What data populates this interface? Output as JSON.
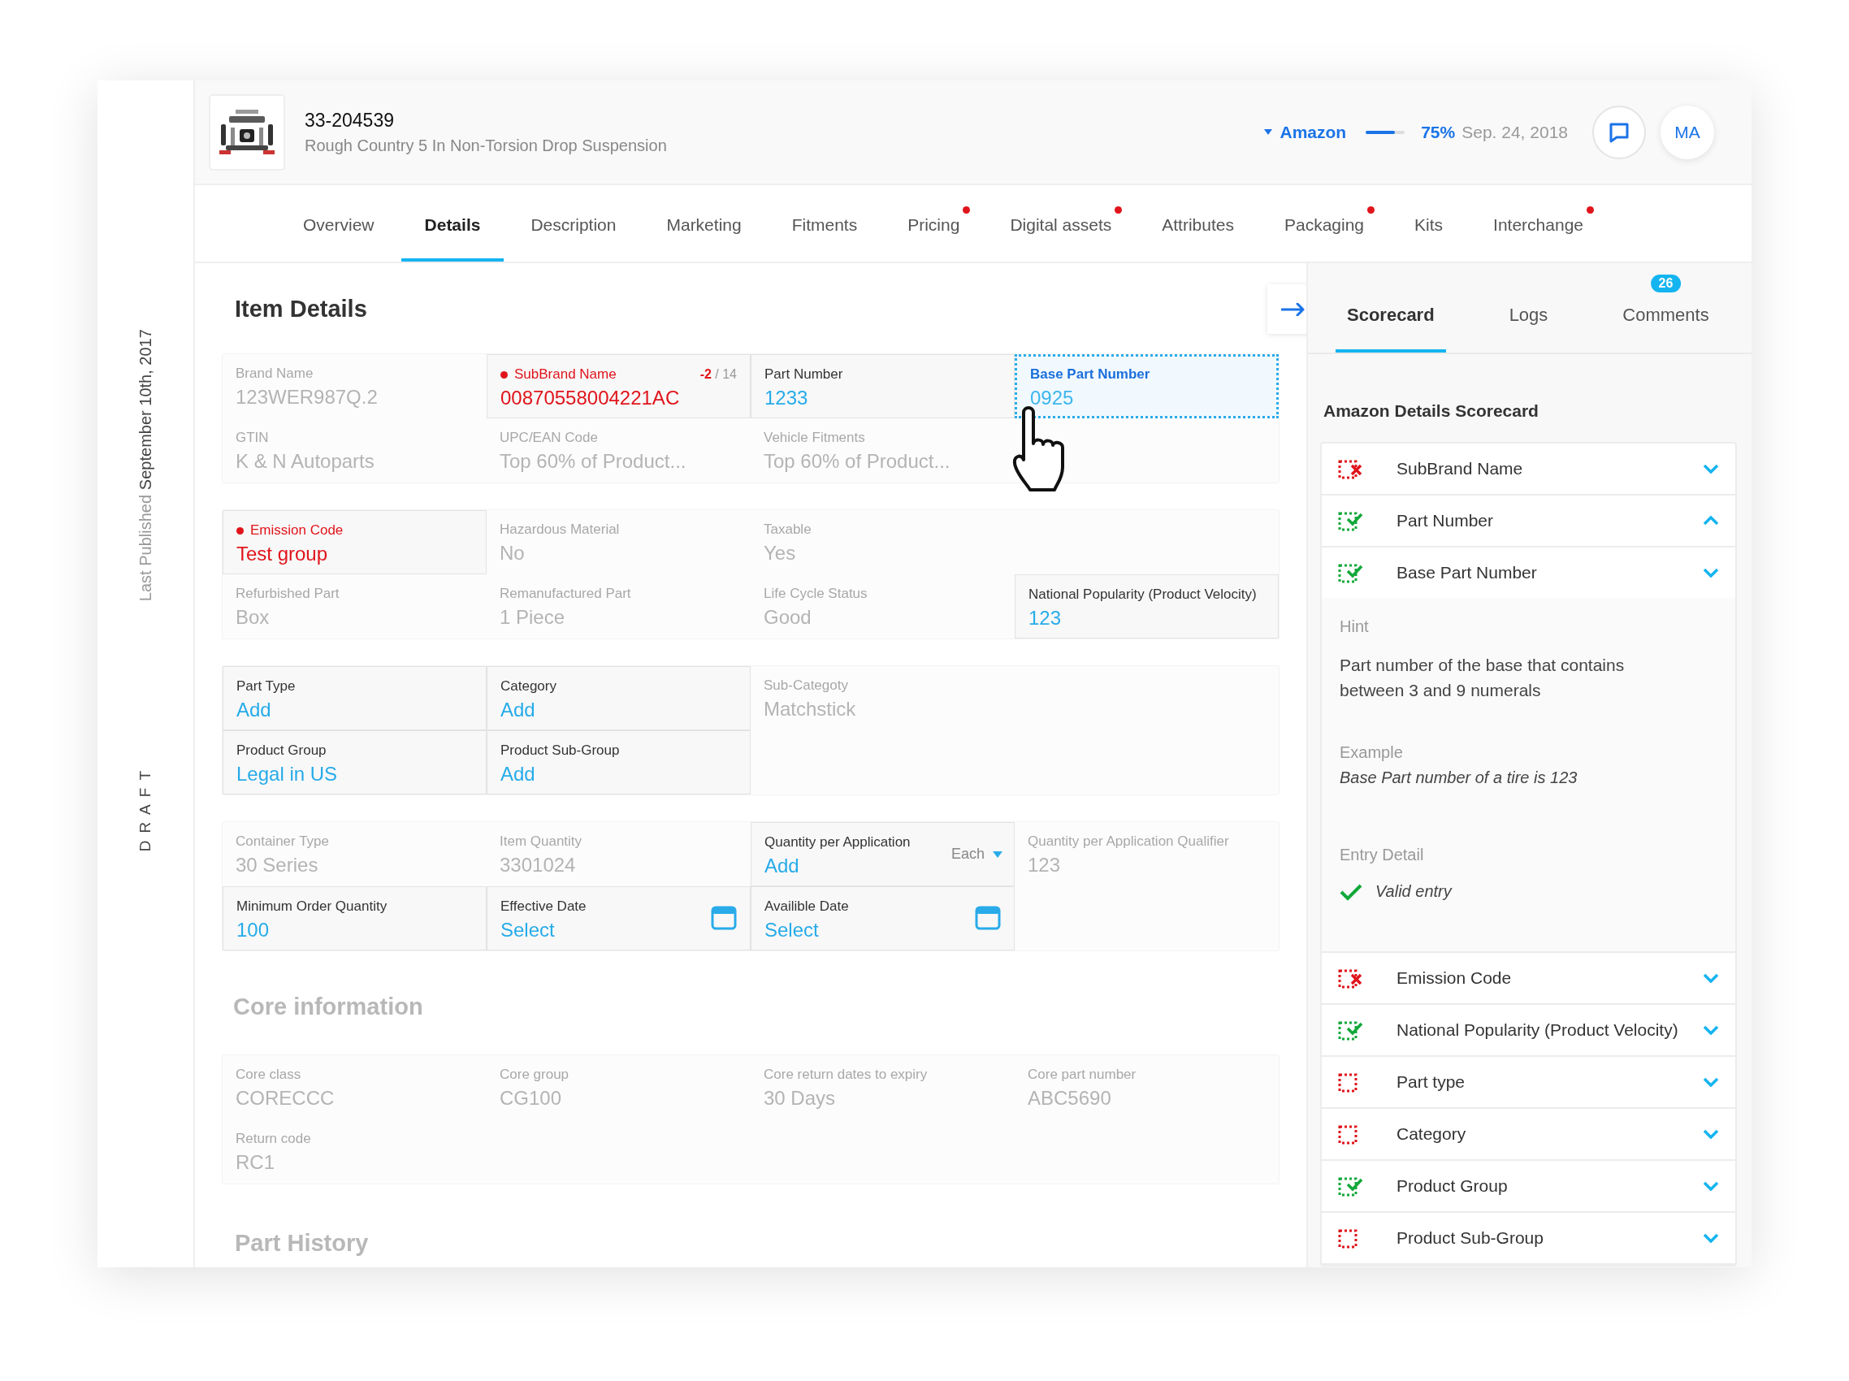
{
  "sidebar": {
    "published_label": "Last Published",
    "published_date": "September 10th, 2017",
    "status": "DRAFT"
  },
  "product": {
    "number": "33-204539",
    "name": "Rough Country 5 In Non-Torsion Drop Suspension"
  },
  "channel": {
    "name": "Amazon",
    "level": 0.75,
    "percent": "75%",
    "date": "Sep. 24, 2018"
  },
  "user": {
    "initials": "MA"
  },
  "tabs": [
    {
      "label": "Overview",
      "selected": false,
      "alert": false
    },
    {
      "label": "Details",
      "selected": true,
      "alert": false
    },
    {
      "label": "Description",
      "selected": false,
      "alert": false
    },
    {
      "label": "Marketing",
      "selected": false,
      "alert": false
    },
    {
      "label": "Fitments",
      "selected": false,
      "alert": false
    },
    {
      "label": "Pricing",
      "selected": false,
      "alert": true
    },
    {
      "label": "Digital assets",
      "selected": false,
      "alert": true
    },
    {
      "label": "Attributes",
      "selected": false,
      "alert": false
    },
    {
      "label": "Packaging",
      "selected": false,
      "alert": true
    },
    {
      "label": "Kits",
      "selected": false,
      "alert": false
    },
    {
      "label": "Interchange",
      "selected": false,
      "alert": true
    }
  ],
  "item_details": {
    "title": "Item Details",
    "sections": [
      {
        "rows": [
          [
            {
              "label": "Brand Name",
              "value": "123WER987Q.2",
              "kind": "text",
              "disabled": true,
              "invalid": false,
              "focused": false
            },
            {
              "label": "SubBrand Name",
              "value": "00870558004221AC",
              "kind": "counter",
              "disabled": false,
              "invalid": true,
              "focused": false,
              "counter": {
                "delta": "-2",
                "limit": "/ 14"
              }
            },
            {
              "label": "Part Number",
              "value": "1233",
              "kind": "text",
              "disabled": false,
              "invalid": false,
              "focused": false
            },
            {
              "label": "Base Part Number",
              "value": "0925",
              "kind": "text",
              "disabled": false,
              "invalid": false,
              "focused": true
            }
          ],
          [
            {
              "label": "GTIN",
              "value": "K & N Autoparts",
              "kind": "text",
              "disabled": true,
              "invalid": false,
              "focused": false
            },
            {
              "label": "UPC/EAN Code",
              "value": "Top 60% of Product...",
              "kind": "text",
              "disabled": true,
              "invalid": false,
              "focused": false
            },
            {
              "label": "Vehicle Fitments",
              "value": "Top 60% of Product...",
              "kind": "text",
              "disabled": true,
              "invalid": false,
              "focused": false
            }
          ]
        ]
      },
      {
        "rows": [
          [
            {
              "label": "Emission Code",
              "value": "Test group",
              "kind": "text",
              "disabled": false,
              "invalid": true,
              "focused": false
            },
            {
              "label": "Hazardous Material",
              "value": "No",
              "kind": "text",
              "disabled": true,
              "invalid": false,
              "focused": false
            },
            {
              "label": "Taxable",
              "value": "Yes",
              "kind": "text",
              "disabled": true,
              "invalid": false,
              "focused": false
            }
          ],
          [
            {
              "label": "Refurbished Part",
              "value": "Box",
              "kind": "text",
              "disabled": true,
              "invalid": false,
              "focused": false
            },
            {
              "label": "Remanufactured Part",
              "value": "1 Piece",
              "kind": "text",
              "disabled": true,
              "invalid": false,
              "focused": false
            },
            {
              "label": "Life Cycle Status",
              "value": "Good",
              "kind": "text",
              "disabled": true,
              "invalid": false,
              "focused": false
            },
            {
              "label": "National Popularity (Product Velocity)",
              "value": "123",
              "kind": "text",
              "disabled": false,
              "invalid": false,
              "focused": false
            }
          ]
        ]
      },
      {
        "rows": [
          [
            {
              "label": "Part Type",
              "value": "Add",
              "kind": "text",
              "disabled": false,
              "invalid": false,
              "focused": false
            },
            {
              "label": "Category",
              "value": "Add",
              "kind": "text",
              "disabled": false,
              "invalid": false,
              "focused": false
            },
            {
              "label": "Sub-Categoty",
              "value": "Matchstick",
              "kind": "text",
              "disabled": true,
              "invalid": false,
              "focused": false
            }
          ],
          [
            {
              "label": "Product Group",
              "value": "Legal in US",
              "kind": "text",
              "disabled": false,
              "invalid": false,
              "focused": false
            },
            {
              "label": "Product Sub-Group",
              "value": "Add",
              "kind": "text",
              "disabled": false,
              "invalid": false,
              "focused": false
            }
          ]
        ]
      },
      {
        "rows": [
          [
            {
              "label": "Container Type",
              "value": "30 Series",
              "kind": "text",
              "disabled": true,
              "invalid": false,
              "focused": false
            },
            {
              "label": "Item Quantity",
              "value": "3301024",
              "kind": "text",
              "disabled": true,
              "invalid": false,
              "focused": false
            },
            {
              "label": "Quantity per Application",
              "value": "Add",
              "kind": "dropdown",
              "disabled": false,
              "invalid": false,
              "focused": false,
              "unit": "Each"
            },
            {
              "label": "Quantity per Application Qualifier",
              "value": "123",
              "kind": "text",
              "disabled": true,
              "invalid": false,
              "focused": false
            }
          ],
          [
            {
              "label": "Minimum Order Quantity",
              "value": "100",
              "kind": "text",
              "disabled": false,
              "invalid": false,
              "focused": false
            },
            {
              "label": "Effective Date",
              "value": "Select",
              "kind": "date",
              "disabled": false,
              "invalid": false,
              "focused": false
            },
            {
              "label": "Availible Date",
              "value": "Select",
              "kind": "date",
              "disabled": false,
              "invalid": false,
              "focused": false
            }
          ]
        ]
      }
    ]
  },
  "core_information": {
    "title": "Core information",
    "sections": [
      {
        "rows": [
          [
            {
              "label": "Core class",
              "value": "CORECCC",
              "kind": "text",
              "disabled": true,
              "invalid": false,
              "focused": false
            },
            {
              "label": "Core group",
              "value": "CG100",
              "kind": "text",
              "disabled": true,
              "invalid": false,
              "focused": false
            },
            {
              "label": "Core return dates to expiry",
              "value": "30 Days",
              "kind": "text",
              "disabled": true,
              "invalid": false,
              "focused": false
            },
            {
              "label": "Core part number",
              "value": "ABC5690",
              "kind": "text",
              "disabled": true,
              "invalid": false,
              "focused": false
            }
          ],
          [
            {
              "label": "Return code",
              "value": "RC1",
              "kind": "text",
              "disabled": true,
              "invalid": false,
              "focused": false
            }
          ]
        ]
      }
    ]
  },
  "part_history": {
    "title": "Part History"
  },
  "panel": {
    "tabs": [
      {
        "label": "Scorecard",
        "selected": true
      },
      {
        "label": "Logs",
        "selected": false
      },
      {
        "label": "Comments",
        "selected": false,
        "badge": "26"
      }
    ],
    "title": "Amazon Details Scorecard",
    "items": [
      {
        "label": "SubBrand Name",
        "kind": "fail",
        "expanded": false
      },
      {
        "label": "Part Number",
        "kind": "pass",
        "expanded": true
      },
      {
        "label": "Base Part Number",
        "kind": "pass",
        "expanded": false,
        "detail": {
          "hint_label": "Hint",
          "hint": "Part number of the base that contains between 3 and 9 numerals",
          "example_label": "Example",
          "example": "Base Part number of a tire is 123",
          "entry_label": "Entry Detail",
          "entry": "Valid entry",
          "valid": true
        }
      },
      {
        "label": "Emission Code",
        "kind": "fail",
        "expanded": false
      },
      {
        "label": "National Popularity (Product Velocity)",
        "kind": "pass",
        "expanded": false
      },
      {
        "label": "Part type",
        "kind": "missing",
        "expanded": false
      },
      {
        "label": "Category",
        "kind": "missing",
        "expanded": false
      },
      {
        "label": "Product Group",
        "kind": "pass",
        "expanded": false
      },
      {
        "label": "Product Sub-Group",
        "kind": "missing",
        "expanded": false
      }
    ]
  }
}
